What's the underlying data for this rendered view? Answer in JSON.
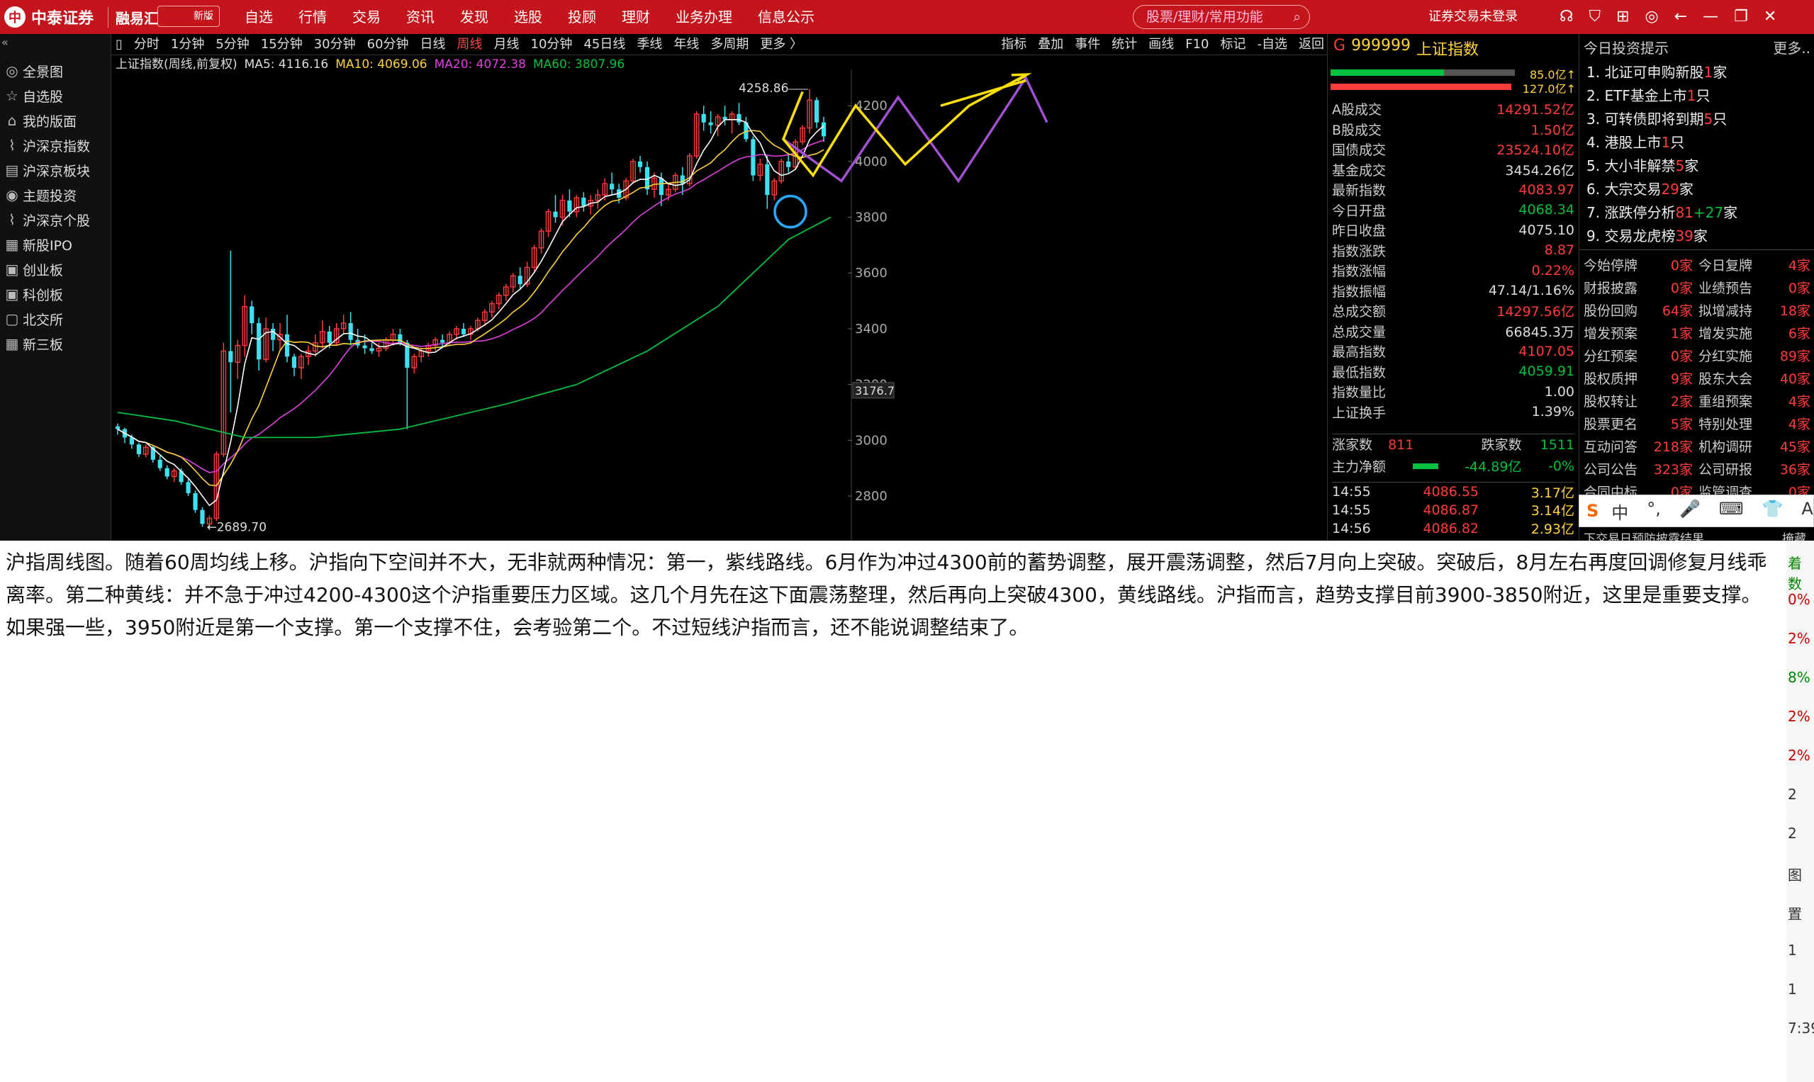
{
  "topbar": {
    "logo_text": "中泰证券",
    "logo_mark": "中",
    "app_name": "融易汇",
    "version": "新版",
    "menu": [
      "自选",
      "行情",
      "交易",
      "资讯",
      "发现",
      "选股",
      "投顾",
      "理财",
      "业务办理",
      "信息公示"
    ],
    "search_placeholder": "股票/理财/常用功能",
    "login": "证券交易未登录"
  },
  "sidebar": {
    "items": [
      {
        "label": "全景图",
        "icon": "globe-icon"
      },
      {
        "label": "自选股",
        "icon": "star-icon"
      },
      {
        "label": "我的版面",
        "icon": "home-icon"
      },
      {
        "label": "沪深京指数",
        "icon": "index-icon"
      },
      {
        "label": "沪深京板块",
        "icon": "sector-icon"
      },
      {
        "label": "主题投资",
        "icon": "target-icon"
      },
      {
        "label": "沪深京个股",
        "icon": "stock-icon"
      },
      {
        "label": "新股IPO",
        "icon": "ipo-icon"
      },
      {
        "label": "创业板",
        "icon": "board-icon"
      },
      {
        "label": "科创板",
        "icon": "star-board-icon"
      },
      {
        "label": "北交所",
        "icon": "exchange-icon"
      },
      {
        "label": "新三板",
        "icon": "new-board-icon"
      }
    ]
  },
  "periods": {
    "items": [
      "分时",
      "1分钟",
      "5分钟",
      "15分钟",
      "30分钟",
      "60分钟",
      "日线",
      "周线",
      "月线",
      "10分钟",
      "45日线",
      "季线",
      "年线",
      "多周期",
      "更多 〉"
    ],
    "active": "周线",
    "tools": [
      "指标",
      "叠加",
      "事件",
      "统计",
      "画线",
      "F10",
      "标记",
      "-自选",
      "返回"
    ]
  },
  "chart_info": {
    "title": "上证指数(周线,前复权)",
    "ma5": "MA5: 4116.16",
    "ma10": "MA10: 4069.06",
    "ma20": "MA20: 4072.38",
    "ma60": "MA60: 3807.96",
    "colors": {
      "ma5": "#ffffff",
      "ma10": "#ffd23b",
      "ma20": "#e040e0",
      "ma60": "#00c040",
      "up": "#ff3b3b",
      "down": "#3de0f0"
    }
  },
  "chart_data": {
    "type": "candlestick",
    "title": "上证指数(周线,前复权)",
    "yticks": [
      4200,
      4000,
      3800,
      3600,
      3400,
      3200,
      3000,
      2800
    ],
    "ylim": [
      2640,
      4330
    ],
    "high_label": "4258.86",
    "low_label": "2689.70",
    "current_price_label": "3176.7",
    "ohlc": [
      [
        3050,
        3060,
        3020,
        3040
      ],
      [
        3040,
        3045,
        2990,
        3010
      ],
      [
        3010,
        3020,
        2970,
        2985
      ],
      [
        2985,
        2990,
        2940,
        2950
      ],
      [
        2950,
        2985,
        2940,
        2975
      ],
      [
        2975,
        2980,
        2920,
        2930
      ],
      [
        2930,
        2945,
        2890,
        2900
      ],
      [
        2900,
        2910,
        2860,
        2870
      ],
      [
        2870,
        2900,
        2850,
        2890
      ],
      [
        2890,
        2900,
        2840,
        2850
      ],
      [
        2850,
        2860,
        2800,
        2810
      ],
      [
        2810,
        2820,
        2740,
        2750
      ],
      [
        2750,
        2760,
        2690,
        2700
      ],
      [
        2700,
        2730,
        2690,
        2720
      ],
      [
        2720,
        2960,
        2710,
        2950
      ],
      [
        2950,
        3350,
        2940,
        3320
      ],
      [
        3320,
        3680,
        3100,
        3280
      ],
      [
        3280,
        3360,
        3220,
        3340
      ],
      [
        3340,
        3520,
        3300,
        3480
      ],
      [
        3480,
        3500,
        3380,
        3420
      ],
      [
        3420,
        3440,
        3250,
        3290
      ],
      [
        3290,
        3440,
        3280,
        3400
      ],
      [
        3400,
        3420,
        3320,
        3360
      ],
      [
        3360,
        3420,
        3320,
        3380
      ],
      [
        3380,
        3450,
        3280,
        3300
      ],
      [
        3300,
        3310,
        3230,
        3260
      ],
      [
        3260,
        3310,
        3220,
        3300
      ],
      [
        3300,
        3340,
        3270,
        3320
      ],
      [
        3320,
        3380,
        3300,
        3350
      ],
      [
        3350,
        3430,
        3330,
        3390
      ],
      [
        3390,
        3410,
        3330,
        3350
      ],
      [
        3350,
        3420,
        3340,
        3400
      ],
      [
        3400,
        3450,
        3380,
        3420
      ],
      [
        3420,
        3460,
        3340,
        3360
      ],
      [
        3360,
        3400,
        3330,
        3340
      ],
      [
        3340,
        3380,
        3310,
        3330
      ],
      [
        3330,
        3350,
        3310,
        3320
      ],
      [
        3320,
        3350,
        3300,
        3330
      ],
      [
        3330,
        3370,
        3320,
        3360
      ],
      [
        3360,
        3400,
        3340,
        3380
      ],
      [
        3380,
        3400,
        3340,
        3350
      ],
      [
        3350,
        3360,
        3040,
        3260
      ],
      [
        3260,
        3310,
        3240,
        3300
      ],
      [
        3300,
        3330,
        3280,
        3320
      ],
      [
        3320,
        3350,
        3300,
        3340
      ],
      [
        3340,
        3370,
        3320,
        3360
      ],
      [
        3360,
        3380,
        3330,
        3350
      ],
      [
        3350,
        3390,
        3340,
        3380
      ],
      [
        3380,
        3410,
        3360,
        3400
      ],
      [
        3400,
        3420,
        3370,
        3380
      ],
      [
        3380,
        3410,
        3360,
        3400
      ],
      [
        3400,
        3440,
        3390,
        3430
      ],
      [
        3430,
        3470,
        3410,
        3460
      ],
      [
        3460,
        3500,
        3440,
        3490
      ],
      [
        3490,
        3530,
        3470,
        3520
      ],
      [
        3520,
        3560,
        3500,
        3550
      ],
      [
        3550,
        3600,
        3530,
        3590
      ],
      [
        3590,
        3620,
        3540,
        3560
      ],
      [
        3560,
        3640,
        3550,
        3620
      ],
      [
        3620,
        3700,
        3600,
        3690
      ],
      [
        3690,
        3760,
        3670,
        3750
      ],
      [
        3750,
        3830,
        3730,
        3820
      ],
      [
        3820,
        3880,
        3780,
        3800
      ],
      [
        3800,
        3880,
        3770,
        3860
      ],
      [
        3860,
        3900,
        3800,
        3820
      ],
      [
        3820,
        3880,
        3800,
        3870
      ],
      [
        3870,
        3890,
        3820,
        3840
      ],
      [
        3840,
        3880,
        3810,
        3860
      ],
      [
        3860,
        3900,
        3830,
        3880
      ],
      [
        3880,
        3940,
        3860,
        3920
      ],
      [
        3920,
        3960,
        3880,
        3900
      ],
      [
        3900,
        3920,
        3850,
        3870
      ],
      [
        3870,
        3940,
        3860,
        3930
      ],
      [
        3930,
        4010,
        3920,
        4000
      ],
      [
        4000,
        4020,
        3960,
        3980
      ],
      [
        3980,
        4000,
        3880,
        3900
      ],
      [
        3900,
        3960,
        3870,
        3940
      ],
      [
        3940,
        3960,
        3840,
        3880
      ],
      [
        3880,
        3920,
        3860,
        3900
      ],
      [
        3900,
        3960,
        3890,
        3950
      ],
      [
        3950,
        3980,
        3880,
        3920
      ],
      [
        3920,
        4030,
        3910,
        4020
      ],
      [
        4020,
        4180,
        4010,
        4170
      ],
      [
        4170,
        4200,
        4110,
        4140
      ],
      [
        4140,
        4180,
        4100,
        4130
      ],
      [
        4130,
        4170,
        4090,
        4160
      ],
      [
        4160,
        4200,
        4130,
        4150
      ],
      [
        4150,
        4180,
        4100,
        4170
      ],
      [
        4170,
        4210,
        4130,
        4140
      ],
      [
        4140,
        4160,
        4070,
        4080
      ],
      [
        4080,
        4090,
        3930,
        3950
      ],
      [
        3950,
        4010,
        3930,
        3990
      ],
      [
        3990,
        4020,
        3830,
        3880
      ],
      [
        3880,
        3940,
        3860,
        3930
      ],
      [
        3930,
        4010,
        3920,
        4000
      ],
      [
        4000,
        4030,
        3960,
        3980
      ],
      [
        3980,
        4080,
        3970,
        4070
      ],
      [
        4070,
        4130,
        4060,
        4120
      ],
      [
        4120,
        4259,
        4100,
        4220
      ],
      [
        4220,
        4230,
        4120,
        4140
      ],
      [
        4140,
        4160,
        4070,
        4090
      ]
    ],
    "ma60": [
      [
        0,
        3100
      ],
      [
        8,
        3070
      ],
      [
        18,
        3010
      ],
      [
        28,
        3010
      ],
      [
        40,
        3040
      ],
      [
        55,
        3130
      ],
      [
        65,
        3200
      ],
      [
        75,
        3320
      ],
      [
        85,
        3480
      ],
      [
        95,
        3720
      ],
      [
        101,
        3800
      ]
    ]
  },
  "quote_panel": {
    "code": "999999",
    "name": "上证指数",
    "g_label": "G",
    "bar1_value": "85.0亿↑",
    "bar2_value": "127.0亿↑",
    "rows": [
      {
        "label": "A股成交",
        "value": "14291.52亿",
        "color": "red"
      },
      {
        "label": "B股成交",
        "value": "1.50亿",
        "color": "red"
      },
      {
        "label": "国债成交",
        "value": "23524.10亿",
        "color": "red"
      },
      {
        "label": "基金成交",
        "value": "3454.26亿",
        "color": "white"
      },
      {
        "label": "最新指数",
        "value": "4083.97",
        "color": "red"
      },
      {
        "label": "今日开盘",
        "value": "4068.34",
        "color": "green"
      },
      {
        "label": "昨日收盘",
        "value": "4075.10",
        "color": "white"
      },
      {
        "label": "指数涨跌",
        "value": "8.87",
        "color": "red"
      },
      {
        "label": "指数涨幅",
        "value": "0.22%",
        "color": "red"
      },
      {
        "label": "指数振幅",
        "value": "47.14/1.16%",
        "color": "white"
      },
      {
        "label": "总成交额",
        "value": "14297.56亿",
        "color": "red"
      },
      {
        "label": "总成交量",
        "value": "66845.3万",
        "color": "white"
      },
      {
        "label": "最高指数",
        "value": "4107.05",
        "color": "red"
      },
      {
        "label": "最低指数",
        "value": "4059.91",
        "color": "green"
      },
      {
        "label": "指数量比",
        "value": "1.00",
        "color": "white"
      },
      {
        "label": "上证换手",
        "value": "1.39%",
        "color": "white"
      }
    ],
    "up_label": "涨家数",
    "up_value": "811",
    "down_label": "跌家数",
    "down_value": "1511",
    "flow_label": "主力净额",
    "flow_value": "-44.89亿",
    "flow_pct": "-0%",
    "ticks": [
      {
        "time": "14:55",
        "price": "4086.55",
        "vol": "3.17亿"
      },
      {
        "time": "14:55",
        "price": "4086.87",
        "vol": "3.14亿"
      },
      {
        "time": "14:56",
        "price": "4086.82",
        "vol": "2.93亿"
      }
    ]
  },
  "tips": {
    "title": "今日投资提示",
    "more": "更多..",
    "items": [
      {
        "pre": "1. 北证可申购新股",
        "num": "1",
        "post": "家"
      },
      {
        "pre": "2. ETF基金上市",
        "num": "1",
        "post": "只"
      },
      {
        "pre": "3. 可转债即将到期",
        "num": "5",
        "post": "只"
      },
      {
        "pre": "4. 港股上市",
        "num": "1",
        "post": "只"
      },
      {
        "pre": "5. 大小非解禁",
        "num": "5",
        "post": "家"
      },
      {
        "pre": "6. 大宗交易",
        "num": "29",
        "post": "家"
      },
      {
        "pre": "7. 涨跌停分析",
        "num": "81",
        "num2": "+27",
        "post": "家"
      },
      {
        "pre": "9. 交易龙虎榜",
        "num": "39",
        "post": "家"
      }
    ],
    "stats": [
      {
        "l": "今始停牌",
        "v": "0家",
        "l2": "今日复牌",
        "v2": "4家"
      },
      {
        "l": "财报披露",
        "v": "0家",
        "l2": "业绩预告",
        "v2": "0家"
      },
      {
        "l": "股份回购",
        "v": "64家",
        "l2": "拟增减持",
        "v2": "18家"
      },
      {
        "l": "增发预案",
        "v": "1家",
        "l2": "增发实施",
        "v2": "6家"
      },
      {
        "l": "分红预案",
        "v": "0家",
        "l2": "分红实施",
        "v2": "89家"
      },
      {
        "l": "股权质押",
        "v": "9家",
        "l2": "股东大会",
        "v2": "40家"
      },
      {
        "l": "股权转让",
        "v": "2家",
        "l2": "重组预案",
        "v2": "4家"
      },
      {
        "l": "股票更名",
        "v": "5家",
        "l2": "特别处理",
        "v2": "4家"
      },
      {
        "l": "互动问答",
        "v": "218家",
        "l2": "机构调研",
        "v2": "45家"
      },
      {
        "l": "公司公告",
        "v": "323家",
        "l2": "公司研报",
        "v2": "36家"
      },
      {
        "l": "合同中标",
        "v": "0家",
        "l2": "监管调查",
        "v2": "0家"
      }
    ],
    "bottom": "下交易日预防披露结果",
    "bottom_right": "掩藏"
  },
  "ime": {
    "items": [
      "中",
      "°,",
      "🎤",
      "⌨",
      "👕",
      "AI"
    ]
  },
  "note": {
    "text": "沪指周线图。随着60周均线上移。沪指向下空间并不大，无非就两种情况：第一，紫线路线。6月作为冲过4300前的蓄势调整，展开震荡调整，然后7月向上突破。突破后，8月左右再度回调修复月线乖离率。第二种黄线：并不急于冲过4200-4300这个沪指重要压力区域。这几个月先在这下面震荡整理，然后再向上突破4300，黄线路线。沪指而言，趋势支撑目前3900-3850附近，这里是重要支撑。如果强一些，3950附近是第一个支撑。第一个支撑不住，会考验第二个。不过短线沪指而言，还不能说调整结束了。"
  },
  "rightstrip": {
    "items": [
      "着数",
      "0%",
      "2%",
      "8%",
      "2%",
      "2%",
      "2",
      "2",
      "图",
      "置",
      "1",
      "1",
      "7:39"
    ]
  }
}
